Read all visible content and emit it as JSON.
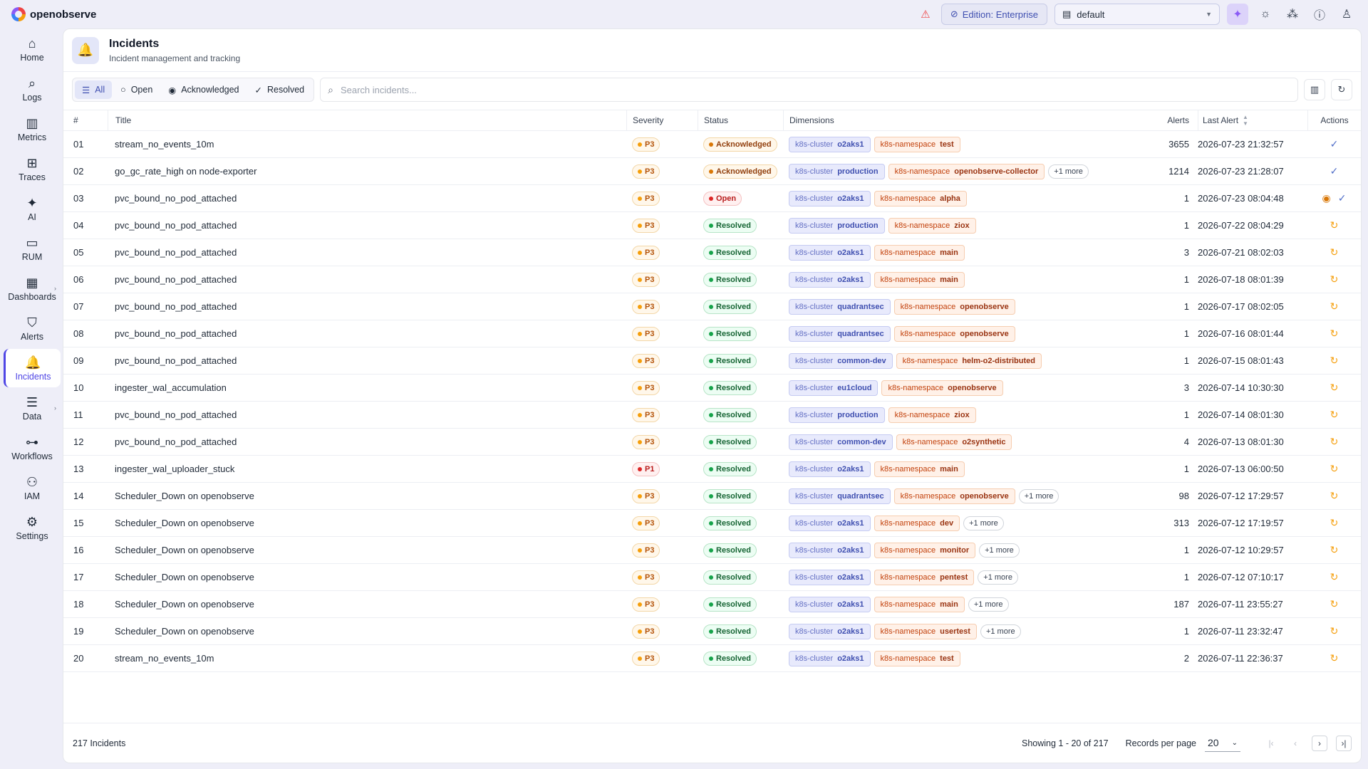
{
  "app": {
    "name": "openobserve"
  },
  "topbar": {
    "edition": "Edition: Enterprise",
    "org": "default"
  },
  "icons": {
    "warning": "triangle-warning-icon",
    "ai": "sparkle-icon",
    "theme": "sun-icon",
    "slack": "slack-icon",
    "help": "help-icon",
    "user": "user-icon"
  },
  "nav": [
    {
      "label": "Home",
      "icon": "⌂",
      "name": "home",
      "active": false,
      "sub": false
    },
    {
      "label": "Logs",
      "icon": "⌕",
      "name": "logs",
      "active": false,
      "sub": false
    },
    {
      "label": "Metrics",
      "icon": "▥",
      "name": "metrics",
      "active": false,
      "sub": false
    },
    {
      "label": "Traces",
      "icon": "⊞",
      "name": "traces",
      "active": false,
      "sub": false
    },
    {
      "label": "AI",
      "icon": "✦",
      "name": "ai",
      "active": false,
      "sub": false
    },
    {
      "label": "RUM",
      "icon": "▭",
      "name": "rum",
      "active": false,
      "sub": false
    },
    {
      "label": "Dashboards",
      "icon": "▦",
      "name": "dashboards",
      "active": false,
      "sub": true
    },
    {
      "label": "Alerts",
      "icon": "⛉",
      "name": "alerts",
      "active": false,
      "sub": false
    },
    {
      "label": "Incidents",
      "icon": "🔔",
      "name": "incidents",
      "active": true,
      "sub": false
    },
    {
      "label": "Data",
      "icon": "☰",
      "name": "data",
      "active": false,
      "sub": true
    },
    {
      "label": "Workflows",
      "icon": "⊶",
      "name": "workflows",
      "active": false,
      "sub": false
    },
    {
      "label": "IAM",
      "icon": "⚇",
      "name": "iam",
      "active": false,
      "sub": false
    },
    {
      "label": "Settings",
      "icon": "⚙",
      "name": "settings",
      "active": false,
      "sub": false
    }
  ],
  "page": {
    "title": "Incidents",
    "subtitle": "Incident management and tracking"
  },
  "filters": [
    {
      "label": "All",
      "icon": "☰",
      "active": true
    },
    {
      "label": "Open",
      "icon": "○",
      "active": false
    },
    {
      "label": "Acknowledged",
      "icon": "◉",
      "active": false
    },
    {
      "label": "Resolved",
      "icon": "✓",
      "active": false
    }
  ],
  "search": {
    "placeholder": "Search incidents..."
  },
  "columns": {
    "num": "#",
    "title": "Title",
    "severity": "Severity",
    "status": "Status",
    "dimensions": "Dimensions",
    "alerts": "Alerts",
    "last_alert": "Last Alert",
    "actions": "Actions"
  },
  "rows": [
    {
      "num": "01",
      "title": "stream_no_events_10m",
      "severity": "P3",
      "status": "Acknowledged",
      "cluster": "o2aks1",
      "namespace": "test",
      "more": "",
      "alerts": "3655",
      "last": "2026-07-23 21:32:57",
      "actions": [
        "resolve"
      ]
    },
    {
      "num": "02",
      "title": "go_gc_rate_high on node-exporter",
      "severity": "P3",
      "status": "Acknowledged",
      "cluster": "production",
      "namespace": "openobserve-collector",
      "more": "+1 more",
      "alerts": "1214",
      "last": "2026-07-23 21:28:07",
      "actions": [
        "resolve"
      ]
    },
    {
      "num": "03",
      "title": "pvc_bound_no_pod_attached",
      "severity": "P3",
      "status": "Open",
      "cluster": "o2aks1",
      "namespace": "alpha",
      "more": "",
      "alerts": "1",
      "last": "2026-07-23 08:04:48",
      "actions": [
        "acknowledge",
        "resolve"
      ]
    },
    {
      "num": "04",
      "title": "pvc_bound_no_pod_attached",
      "severity": "P3",
      "status": "Resolved",
      "cluster": "production",
      "namespace": "ziox",
      "more": "",
      "alerts": "1",
      "last": "2026-07-22 08:04:29",
      "actions": [
        "reopen"
      ]
    },
    {
      "num": "05",
      "title": "pvc_bound_no_pod_attached",
      "severity": "P3",
      "status": "Resolved",
      "cluster": "o2aks1",
      "namespace": "main",
      "more": "",
      "alerts": "3",
      "last": "2026-07-21 08:02:03",
      "actions": [
        "reopen"
      ]
    },
    {
      "num": "06",
      "title": "pvc_bound_no_pod_attached",
      "severity": "P3",
      "status": "Resolved",
      "cluster": "o2aks1",
      "namespace": "main",
      "more": "",
      "alerts": "1",
      "last": "2026-07-18 08:01:39",
      "actions": [
        "reopen"
      ]
    },
    {
      "num": "07",
      "title": "pvc_bound_no_pod_attached",
      "severity": "P3",
      "status": "Resolved",
      "cluster": "quadrantsec",
      "namespace": "openobserve",
      "more": "",
      "alerts": "1",
      "last": "2026-07-17 08:02:05",
      "actions": [
        "reopen"
      ]
    },
    {
      "num": "08",
      "title": "pvc_bound_no_pod_attached",
      "severity": "P3",
      "status": "Resolved",
      "cluster": "quadrantsec",
      "namespace": "openobserve",
      "more": "",
      "alerts": "1",
      "last": "2026-07-16 08:01:44",
      "actions": [
        "reopen"
      ]
    },
    {
      "num": "09",
      "title": "pvc_bound_no_pod_attached",
      "severity": "P3",
      "status": "Resolved",
      "cluster": "common-dev",
      "namespace": "helm-o2-distributed",
      "more": "",
      "alerts": "1",
      "last": "2026-07-15 08:01:43",
      "actions": [
        "reopen"
      ]
    },
    {
      "num": "10",
      "title": "ingester_wal_accumulation",
      "severity": "P3",
      "status": "Resolved",
      "cluster": "eu1cloud",
      "namespace": "openobserve",
      "more": "",
      "alerts": "3",
      "last": "2026-07-14 10:30:30",
      "actions": [
        "reopen"
      ]
    },
    {
      "num": "11",
      "title": "pvc_bound_no_pod_attached",
      "severity": "P3",
      "status": "Resolved",
      "cluster": "production",
      "namespace": "ziox",
      "more": "",
      "alerts": "1",
      "last": "2026-07-14 08:01:30",
      "actions": [
        "reopen"
      ]
    },
    {
      "num": "12",
      "title": "pvc_bound_no_pod_attached",
      "severity": "P3",
      "status": "Resolved",
      "cluster": "common-dev",
      "namespace": "o2synthetic",
      "more": "",
      "alerts": "4",
      "last": "2026-07-13 08:01:30",
      "actions": [
        "reopen"
      ]
    },
    {
      "num": "13",
      "title": "ingester_wal_uploader_stuck",
      "severity": "P1",
      "status": "Resolved",
      "cluster": "o2aks1",
      "namespace": "main",
      "more": "",
      "alerts": "1",
      "last": "2026-07-13 06:00:50",
      "actions": [
        "reopen"
      ]
    },
    {
      "num": "14",
      "title": "Scheduler_Down on openobserve",
      "severity": "P3",
      "status": "Resolved",
      "cluster": "quadrantsec",
      "namespace": "openobserve",
      "more": "+1 more",
      "alerts": "98",
      "last": "2026-07-12 17:29:57",
      "actions": [
        "reopen"
      ]
    },
    {
      "num": "15",
      "title": "Scheduler_Down on openobserve",
      "severity": "P3",
      "status": "Resolved",
      "cluster": "o2aks1",
      "namespace": "dev",
      "more": "+1 more",
      "alerts": "313",
      "last": "2026-07-12 17:19:57",
      "actions": [
        "reopen"
      ]
    },
    {
      "num": "16",
      "title": "Scheduler_Down on openobserve",
      "severity": "P3",
      "status": "Resolved",
      "cluster": "o2aks1",
      "namespace": "monitor",
      "more": "+1 more",
      "alerts": "1",
      "last": "2026-07-12 10:29:57",
      "actions": [
        "reopen"
      ]
    },
    {
      "num": "17",
      "title": "Scheduler_Down on openobserve",
      "severity": "P3",
      "status": "Resolved",
      "cluster": "o2aks1",
      "namespace": "pentest",
      "more": "+1 more",
      "alerts": "1",
      "last": "2026-07-12 07:10:17",
      "actions": [
        "reopen"
      ]
    },
    {
      "num": "18",
      "title": "Scheduler_Down on openobserve",
      "severity": "P3",
      "status": "Resolved",
      "cluster": "o2aks1",
      "namespace": "main",
      "more": "+1 more",
      "alerts": "187",
      "last": "2026-07-11 23:55:27",
      "actions": [
        "reopen"
      ]
    },
    {
      "num": "19",
      "title": "Scheduler_Down on openobserve",
      "severity": "P3",
      "status": "Resolved",
      "cluster": "o2aks1",
      "namespace": "usertest",
      "more": "+1 more",
      "alerts": "1",
      "last": "2026-07-11 23:32:47",
      "actions": [
        "reopen"
      ]
    },
    {
      "num": "20",
      "title": "stream_no_events_10m",
      "severity": "P3",
      "status": "Resolved",
      "cluster": "o2aks1",
      "namespace": "test",
      "more": "",
      "alerts": "2",
      "last": "2026-07-11 22:36:37",
      "actions": [
        "reopen"
      ]
    }
  ],
  "dim_keys": {
    "cluster": "k8s-cluster",
    "namespace": "k8s-namespace"
  },
  "footer": {
    "total": "217 Incidents",
    "showing": "Showing 1 - 20 of 217",
    "rpp_label": "Records per page",
    "rpp_value": "20"
  }
}
